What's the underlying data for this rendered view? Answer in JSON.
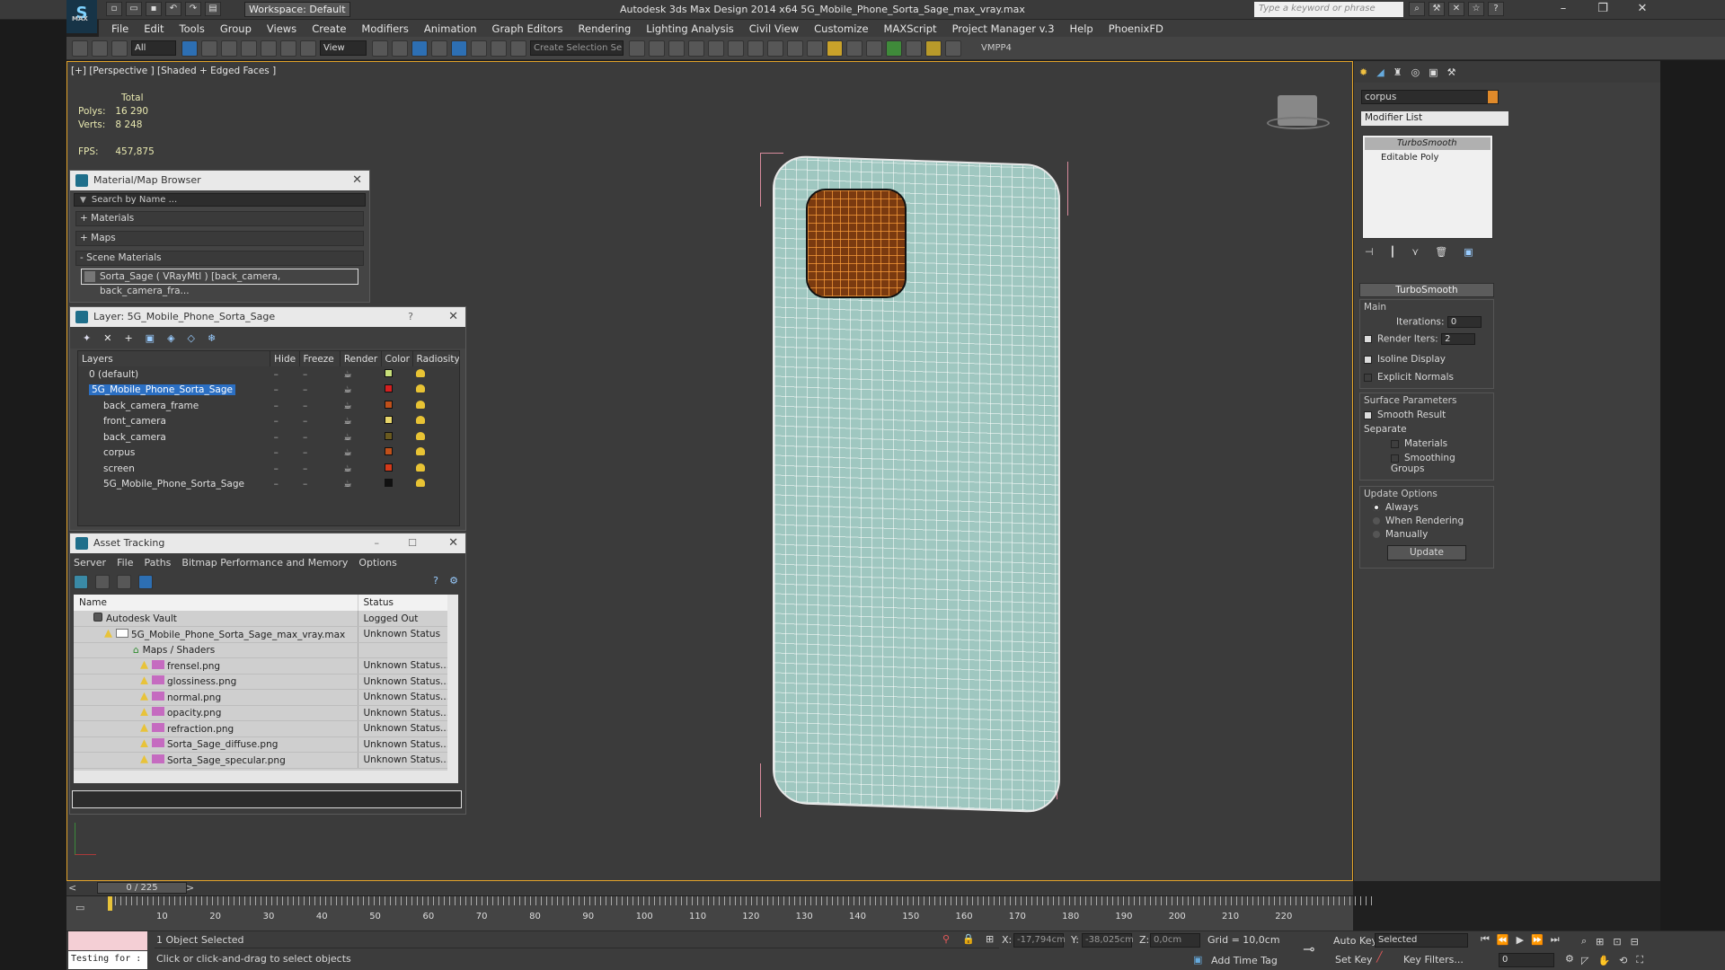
{
  "titlebar": {
    "app_title": "Autodesk 3ds Max Design 2014 x64     5G_Mobile_Phone_Sorta_Sage_max_vray.max",
    "workspace": "Workspace: Default",
    "search_placeholder": "Type a keyword or phrase",
    "logo_text": "MAX"
  },
  "menu": [
    "File",
    "Edit",
    "Tools",
    "Group",
    "Views",
    "Create",
    "Modifiers",
    "Animation",
    "Graph Editors",
    "Rendering",
    "Lighting Analysis",
    "Civil View",
    "Customize",
    "MAXScript",
    "Project Manager v.3",
    "Help",
    "PhoenixFD"
  ],
  "toolbar": {
    "filter_value": "All",
    "refcoord_value": "View",
    "selection_set_placeholder": "Create Selection Se",
    "vmpp": "VMPP4"
  },
  "viewport": {
    "label": "[+] [Perspective ] [Shaded + Edged Faces ]",
    "stats": {
      "total_label": "Total",
      "polys_label": "Polys:",
      "polys_value": "16 290",
      "verts_label": "Verts:",
      "verts_value": "8 248",
      "fps_label": "FPS:",
      "fps_value": "457,875"
    }
  },
  "material_browser": {
    "title": "Material/Map Browser",
    "search_placeholder": "Search by Name ...",
    "groups": [
      "+ Materials",
      "+ Maps",
      "- Scene Materials"
    ],
    "scene_material": "Sorta_Sage  ( VRayMtl )  [back_camera, back_camera_fra..."
  },
  "layer_manager": {
    "title": "Layer: 5G_Mobile_Phone_Sorta_Sage",
    "columns": [
      "Layers",
      "Hide",
      "Freeze",
      "Render",
      "Color",
      "Radiosity"
    ],
    "rows": [
      {
        "name": "0 (default)",
        "color": "#c8e07a"
      },
      {
        "name": "5G_Mobile_Phone_Sorta_Sage",
        "color": "#d42020"
      },
      {
        "name": "back_camera_frame",
        "color": "#c0501a"
      },
      {
        "name": "front_camera",
        "color": "#e8d66a"
      },
      {
        "name": "back_camera",
        "color": "#6a5a20"
      },
      {
        "name": "corpus",
        "color": "#c0501a"
      },
      {
        "name": "screen",
        "color": "#d43a1a"
      },
      {
        "name": "5G_Mobile_Phone_Sorta_Sage",
        "color": "#111111"
      }
    ]
  },
  "asset_tracking": {
    "title": "Asset Tracking",
    "menu": [
      "Server",
      "File",
      "Paths",
      "Bitmap Performance and Memory",
      "Options"
    ],
    "columns": [
      "Name",
      "Status"
    ],
    "rows": [
      {
        "name": "Autodesk Vault",
        "status": "Logged Out"
      },
      {
        "name": "5G_Mobile_Phone_Sorta_Sage_max_vray.max",
        "status": "Unknown Status"
      },
      {
        "name": "Maps / Shaders",
        "status": ""
      },
      {
        "name": "frensel.png",
        "status": "Unknown Status..."
      },
      {
        "name": "glossiness.png",
        "status": "Unknown Status..."
      },
      {
        "name": "normal.png",
        "status": "Unknown Status..."
      },
      {
        "name": "opacity.png",
        "status": "Unknown Status..."
      },
      {
        "name": "refraction.png",
        "status": "Unknown Status..."
      },
      {
        "name": "Sorta_Sage_diffuse.png",
        "status": "Unknown Status..."
      },
      {
        "name": "Sorta_Sage_specular.png",
        "status": "Unknown Status..."
      }
    ]
  },
  "command_panel": {
    "object_name": "corpus",
    "object_color": "#e08a2a",
    "modifier_list": "Modifier List",
    "stack": [
      "TurboSmooth",
      "Editable Poly"
    ],
    "turbosmooth": {
      "header": "TurboSmooth",
      "main_label": "Main",
      "iterations_label": "Iterations:",
      "iterations_value": "0",
      "render_iters_label": "Render Iters:",
      "render_iters_value": "2",
      "isoline": "Isoline Display",
      "explicit_normals": "Explicit Normals",
      "surface_params": "Surface Parameters",
      "smooth_result": "Smooth Result",
      "separate": "Separate",
      "materials": "Materials",
      "smoothing_groups": "Smoothing Groups",
      "update_options": "Update Options",
      "always": "Always",
      "when_rendering": "When Rendering",
      "manually": "Manually",
      "update_button": "Update"
    }
  },
  "timeline": {
    "frame_counter": "0 / 225",
    "ticks": [
      "10",
      "20",
      "30",
      "40",
      "50",
      "60",
      "70",
      "80",
      "90",
      "100",
      "110",
      "120",
      "130",
      "140",
      "150",
      "160",
      "170",
      "180",
      "190",
      "200",
      "210",
      "220"
    ]
  },
  "statusbar": {
    "maxscript_text": "Testing for :",
    "selection_status": "1 Object Selected",
    "prompt": "Click or click-and-drag to select objects",
    "x_label": "X:",
    "x_value": "-17,794cm",
    "y_label": "Y:",
    "y_value": "-38,025cm",
    "z_label": "Z:",
    "z_value": "0,0cm",
    "grid": "Grid = 10,0cm",
    "add_time_tag": "Add Time Tag",
    "auto_key": "Auto Key",
    "set_key": "Set Key",
    "selected": "Selected",
    "key_filters": "Key Filters...",
    "frame_value": "0"
  }
}
